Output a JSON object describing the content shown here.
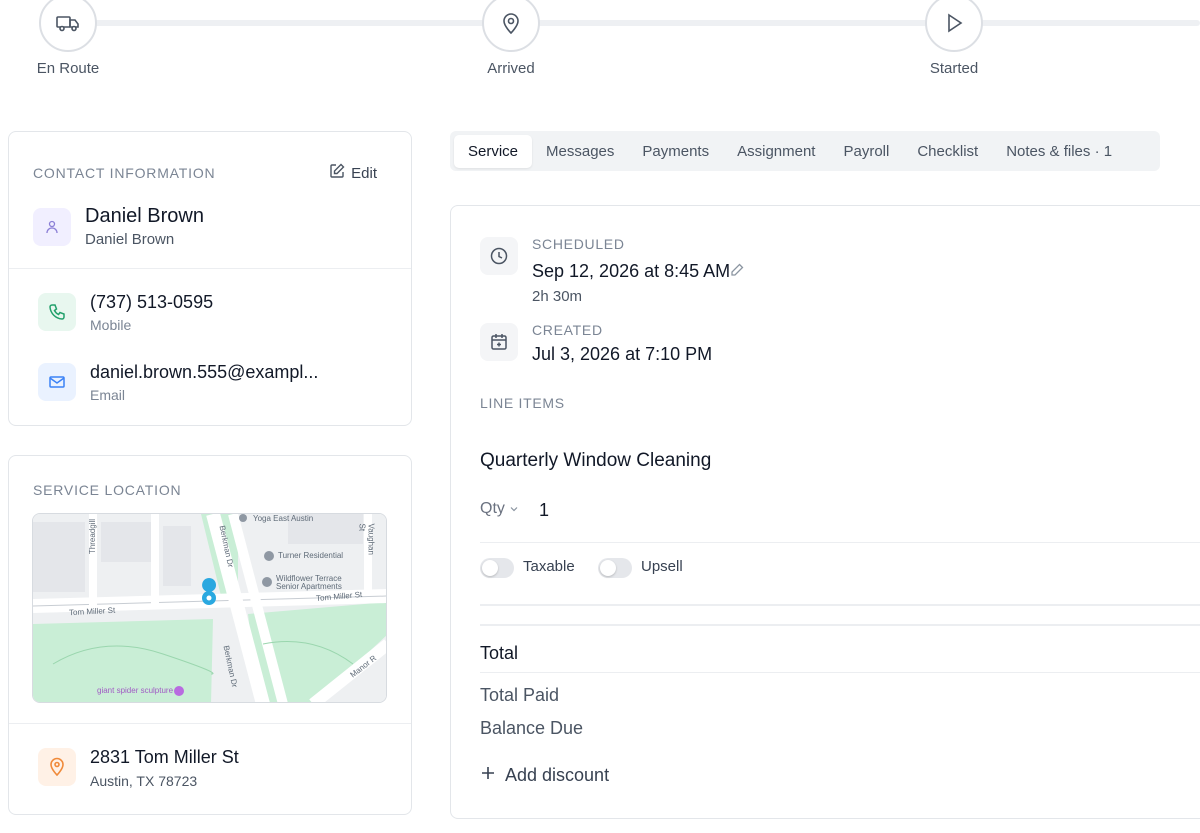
{
  "progress": {
    "steps": [
      {
        "label": "En Route",
        "icon": "truck-icon"
      },
      {
        "label": "Arrived",
        "icon": "map-pin-icon"
      },
      {
        "label": "Started",
        "icon": "play-icon"
      }
    ]
  },
  "contact": {
    "section_title": "CONTACT INFORMATION",
    "edit_label": "Edit",
    "name": "Daniel Brown",
    "subname": "Daniel Brown",
    "phone": "(737) 513-0595",
    "phone_type": "Mobile",
    "email": "daniel.brown.555@exampl...",
    "email_type": "Email"
  },
  "location": {
    "section_title": "SERVICE LOCATION",
    "street": "2831 Tom Miller St",
    "city": "Austin, TX 78723",
    "map": {
      "labels": [
        "Yoga East Austin",
        "Turner Residential",
        "Wildflower Terrace",
        "Senior Apartments",
        "Tom Miller St",
        "Tom Miller St",
        "Berkman Dr",
        "Berkman Dr",
        "Threadgill",
        "Vaughan St",
        "Manor R",
        "giant spider sculpture"
      ]
    }
  },
  "tabs": [
    "Service",
    "Messages",
    "Payments",
    "Assignment",
    "Payroll",
    "Checklist",
    "Notes & files · 1"
  ],
  "active_tab": "Service",
  "service": {
    "scheduled_label": "SCHEDULED",
    "scheduled_value": "Sep 12, 2026 at 8:45 AM",
    "duration": "2h 30m",
    "created_label": "CREATED",
    "created_value": "Jul 3, 2026 at 7:10 PM",
    "line_items_label": "LINE ITEMS",
    "item_name": "Quarterly Window Cleaning",
    "qty_label": "Qty",
    "qty_value": "1",
    "taxable_label": "Taxable",
    "upsell_label": "Upsell",
    "total_label": "Total",
    "total_paid_label": "Total Paid",
    "balance_due_label": "Balance Due",
    "add_discount_label": "Add discount"
  },
  "colors": {
    "person_bg": "#f1efff",
    "phone_bg": "#e8f7ef",
    "email_bg": "#eaf2ff",
    "location_bg": "#fff1e6",
    "map_park": "#c9eed6",
    "map_pin": "#2aa8e0"
  }
}
